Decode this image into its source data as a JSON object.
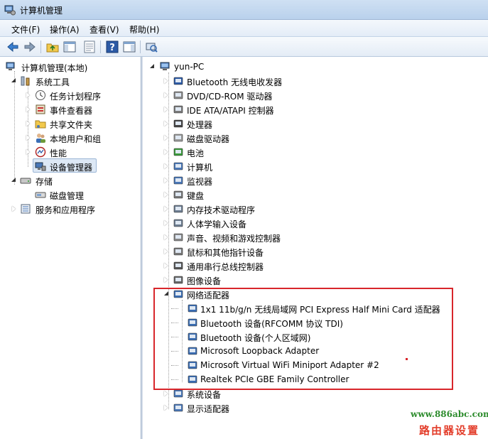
{
  "window": {
    "title": "计算机管理"
  },
  "menu": [
    "文件(F)",
    "操作(A)",
    "查看(V)",
    "帮助(H)"
  ],
  "toolbar": {
    "buttons": [
      "back-arrow-icon",
      "forward-arrow-icon",
      "up-folder-icon",
      "console-tree-icon",
      "properties-icon",
      "help-icon",
      "show-hide-icon",
      "scan-hardware-icon"
    ]
  },
  "left_tree": {
    "root": "计算机管理(本地)",
    "system_tools": "系统工具",
    "system_tools_items": [
      "任务计划程序",
      "事件查看器",
      "共享文件夹",
      "本地用户和组",
      "性能",
      "设备管理器"
    ],
    "storage": "存储",
    "storage_items": [
      "磁盘管理"
    ],
    "services": "服务和应用程序",
    "selected": "设备管理器"
  },
  "device_tree": {
    "computer": "yun-PC",
    "categories": [
      "Bluetooth 无线电收发器",
      "DVD/CD-ROM 驱动器",
      "IDE ATA/ATAPI 控制器",
      "处理器",
      "磁盘驱动器",
      "电池",
      "计算机",
      "监视器",
      "键盘",
      "内存技术驱动程序",
      "人体学输入设备",
      "声音、视频和游戏控制器",
      "鼠标和其他指针设备",
      "通用串行总线控制器",
      "图像设备",
      "网络适配器"
    ],
    "network_adapters": [
      "1x1 11b/g/n 无线局域网 PCI Express Half Mini Card 适配器",
      "Bluetooth 设备(RFCOMM 协议 TDI)",
      "Bluetooth 设备(个人区域网)",
      "Microsoft Loopback Adapter",
      "Microsoft Virtual WiFi Miniport Adapter #2",
      "Realtek PCIe GBE Family Controller"
    ],
    "after": [
      "系统设备",
      "显示适配器"
    ]
  },
  "watermark": {
    "url": "www.886abc.com",
    "text": "路由器设置"
  },
  "colors": {
    "highlight_box": "#d8262b",
    "watermark_url": "#2d8c2d",
    "watermark_text": "#e33d2a"
  }
}
